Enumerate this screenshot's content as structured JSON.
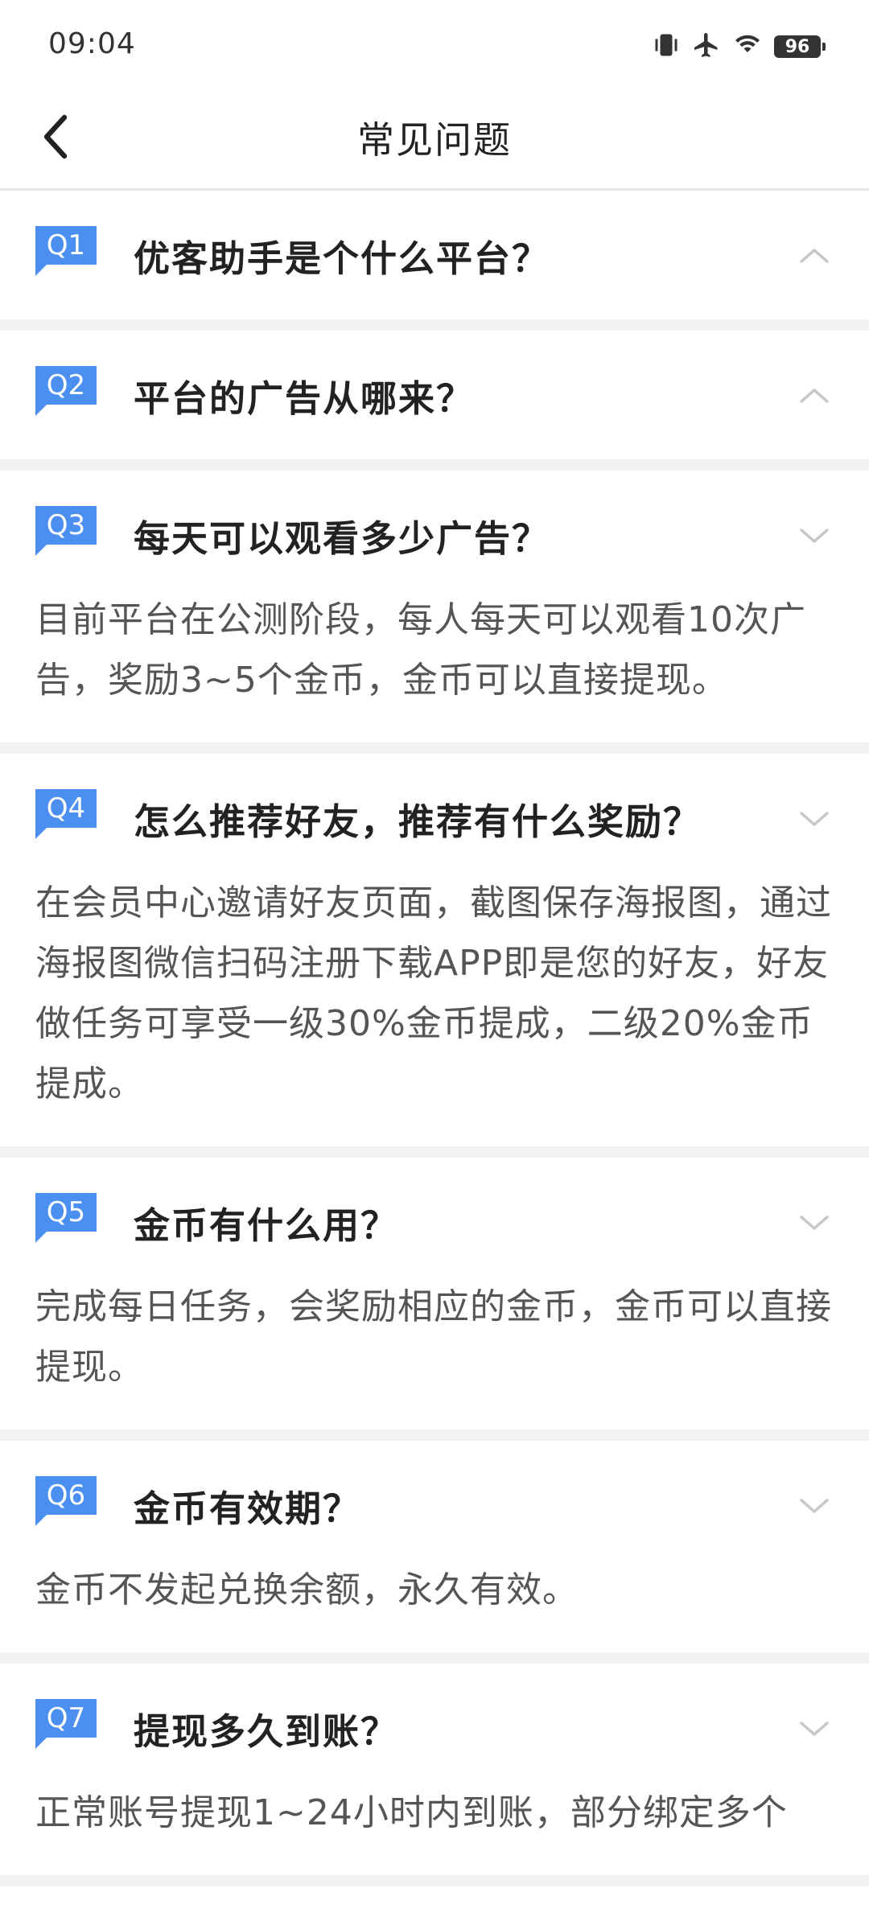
{
  "status_bar": {
    "time": "09:04",
    "battery": "96",
    "icons": [
      "vibrate-icon",
      "airplane-icon",
      "wifi-icon",
      "battery-icon"
    ]
  },
  "nav": {
    "back_icon": "chevron-left-icon",
    "title": "常见问题"
  },
  "faqs": [
    {
      "badge": "Q1",
      "question": "优客助手是个什么平台？",
      "expanded": false,
      "answer": ""
    },
    {
      "badge": "Q2",
      "question": "平台的广告从哪来？",
      "expanded": false,
      "answer": ""
    },
    {
      "badge": "Q3",
      "question": "每天可以观看多少广告？",
      "expanded": true,
      "answer": "目前平台在公测阶段，每人每天可以观看10次广告，奖励3~5个金币，金币可以直接提现。"
    },
    {
      "badge": "Q4",
      "question": "怎么推荐好友，推荐有什么奖励？",
      "expanded": true,
      "answer": "在会员中心邀请好友页面，截图保存海报图，通过海报图微信扫码注册下载APP即是您的好友，好友做任务可享受一级30%金币提成，二级20%金币提成。"
    },
    {
      "badge": "Q5",
      "question": "金币有什么用？",
      "expanded": true,
      "answer": "完成每日任务，会奖励相应的金币，金币可以直接提现。"
    },
    {
      "badge": "Q6",
      "question": "金币有效期？",
      "expanded": true,
      "answer": "金币不发起兑换余额，永久有效。"
    },
    {
      "badge": "Q7",
      "question": "提现多久到账？",
      "expanded": true,
      "answer": "正常账号提现1~24小时内到账，部分绑定多个"
    }
  ],
  "colors": {
    "accent": "#4b8ff0",
    "divider": "#f2f2f2",
    "chevron": "#c8c8c8"
  }
}
